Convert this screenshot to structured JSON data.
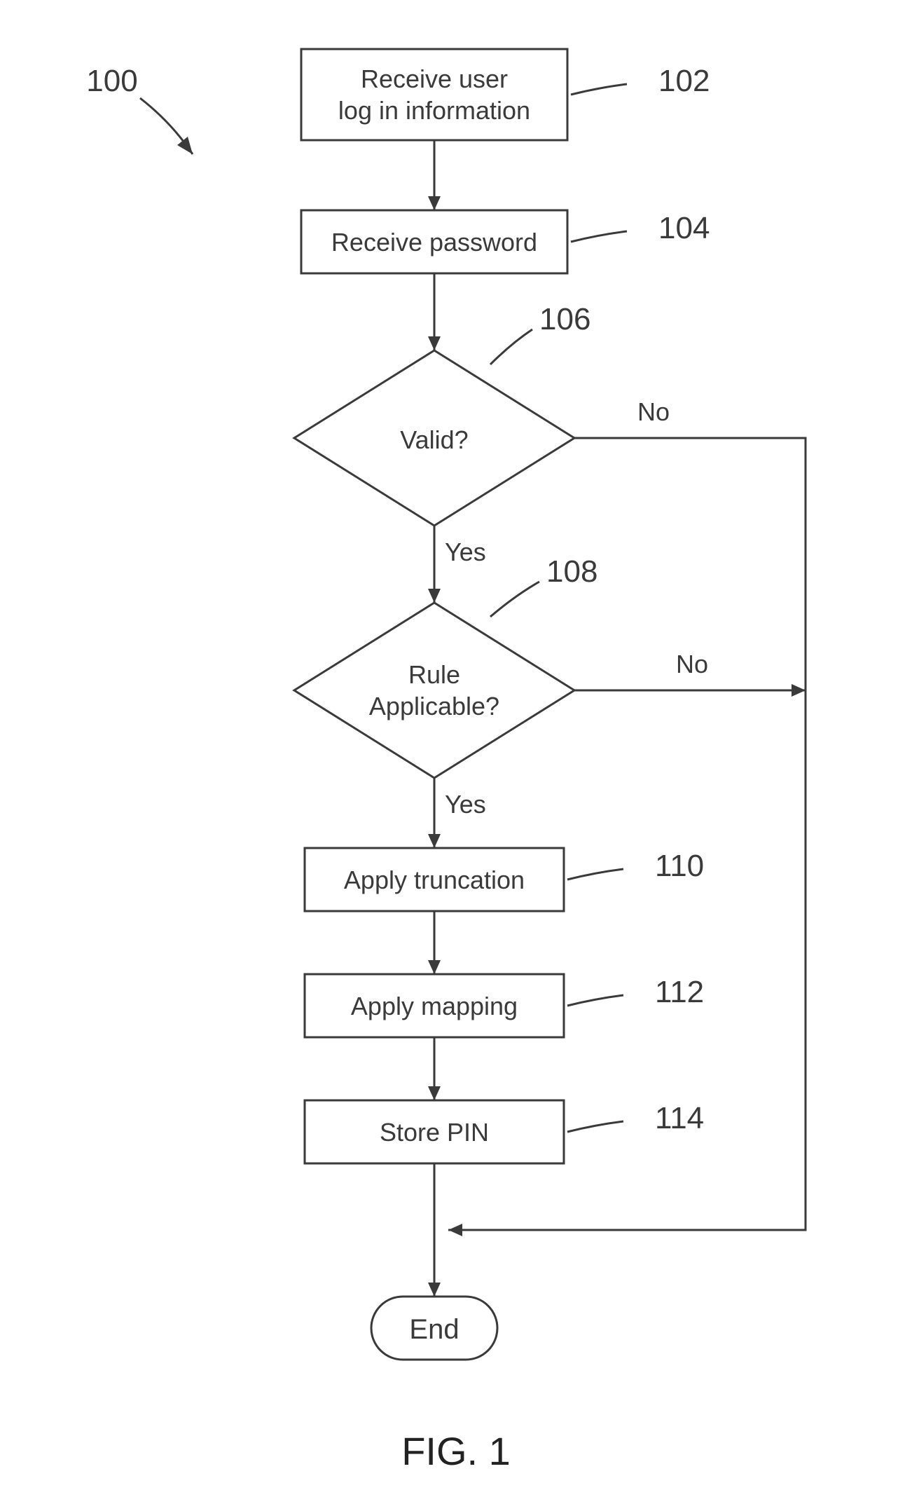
{
  "figure_label": "FIG. 1",
  "diagram_ref": "100",
  "nodes": {
    "n102": {
      "ref": "102",
      "lines": [
        "Receive user",
        "log in information"
      ]
    },
    "n104": {
      "ref": "104",
      "lines": [
        "Receive password"
      ]
    },
    "n106": {
      "ref": "106",
      "lines": [
        "Valid?"
      ]
    },
    "n108": {
      "ref": "108",
      "lines": [
        "Rule",
        "Applicable?"
      ]
    },
    "n110": {
      "ref": "110",
      "lines": [
        "Apply truncation"
      ]
    },
    "n112": {
      "ref": "112",
      "lines": [
        "Apply mapping"
      ]
    },
    "n114": {
      "ref": "114",
      "lines": [
        "Store PIN"
      ]
    },
    "end": {
      "lines": [
        "End"
      ]
    }
  },
  "edges": {
    "e106_yes": "Yes",
    "e106_no": "No",
    "e108_yes": "Yes",
    "e108_no": "No"
  }
}
